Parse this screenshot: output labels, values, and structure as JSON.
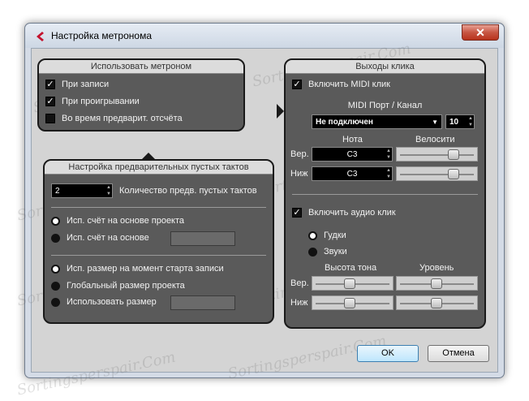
{
  "window": {
    "title": "Настройка метронома",
    "close": "✕"
  },
  "watermark": "Sortingsperspair.Com",
  "use_metronome": {
    "header": "Использовать метроном",
    "items": [
      {
        "label": "При записи",
        "checked": true
      },
      {
        "label": "При проигрывании",
        "checked": true
      },
      {
        "label": "Во время предварит. отсчёта",
        "checked": false
      }
    ]
  },
  "precount": {
    "header": "Настройка предварительных пустых тактов",
    "count_value": "2",
    "count_label": "Количество предв. пустых тактов",
    "tempo_options": [
      {
        "label": "Исп. счёт на основе проекта",
        "selected": true
      },
      {
        "label": "Исп. счёт на основе",
        "selected": false
      }
    ],
    "signature_options": [
      {
        "label": "Исп. размер на момент старта записи",
        "selected": true
      },
      {
        "label": "Глобальный размер проекта",
        "selected": false
      },
      {
        "label": "Использовать размер",
        "selected": false
      }
    ]
  },
  "click_outputs": {
    "header": "Выходы клика",
    "midi_enable": "Включить MIDI клик",
    "midi_port_label": "MIDI Порт / Канал",
    "midi_port_value": "Не подключен",
    "midi_channel": "10",
    "note_label": "Нота",
    "velocity_label": "Велосити",
    "high_label": "Вер.",
    "low_label": "Ниж",
    "high_note": "C3",
    "low_note": "C3",
    "high_velocity": 0.76,
    "low_velocity": 0.76,
    "audio_enable": "Включить аудио клик",
    "audio_options": [
      {
        "label": "Гудки",
        "selected": true
      },
      {
        "label": "Звуки",
        "selected": false
      }
    ],
    "pitch_label": "Высота тона",
    "level_label": "Уровень",
    "high_pitch": 0.47,
    "low_pitch": 0.47,
    "high_level": 0.5,
    "low_level": 0.5
  },
  "buttons": {
    "ok": "OK",
    "cancel": "Отмена"
  }
}
